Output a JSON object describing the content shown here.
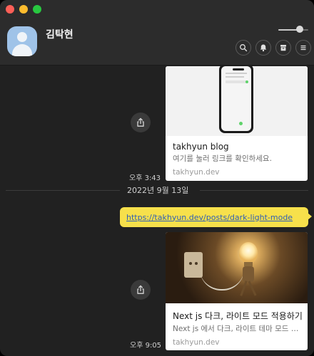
{
  "contact": {
    "name": "김탁현"
  },
  "volume": {
    "level": 0.72
  },
  "toolbar": [
    {
      "name": "search-icon"
    },
    {
      "name": "bell-icon"
    },
    {
      "name": "drawer-icon"
    },
    {
      "name": "menu-icon"
    }
  ],
  "messages": [
    {
      "type": "link-card",
      "title": "takhyun blog",
      "description": "여기를 눌러 링크를 확인하세요.",
      "domain": "takhyun.dev",
      "time": "오후 3:43"
    },
    {
      "type": "date-separator",
      "label": "2022년 9월 13일"
    },
    {
      "type": "text",
      "text": "https://takhyun.dev/posts/dark-light-mode"
    },
    {
      "type": "link-card",
      "title": "Next js 다크, 라이트 모드 적용하기",
      "description": "Next js 에서 다크, 라이트 테마 모드 적용하기",
      "domain": "takhyun.dev",
      "time": "오후 9:05"
    }
  ],
  "colors": {
    "bubble": "#f7e04b",
    "background": "#212121",
    "header": "#2c2c2c"
  }
}
